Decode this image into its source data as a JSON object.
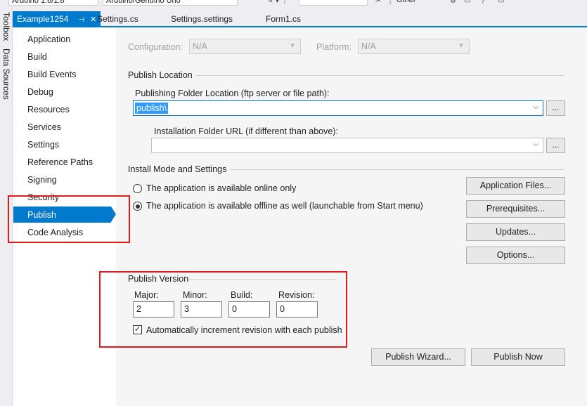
{
  "toolbar": {
    "board_combo": "Arduino 1.6/1.8",
    "port_combo": "Arduino/Genuino Uno",
    "search_combo": "",
    "other_combo": "Other"
  },
  "side_strip": {
    "toolbox": "Toolbox",
    "data_sources": "Data Sources"
  },
  "tabs": [
    {
      "label": "Example1254",
      "active": true
    },
    {
      "label": "Settings.cs"
    },
    {
      "label": "Settings.settings"
    },
    {
      "label": "Form1.cs"
    }
  ],
  "nav": {
    "items": [
      {
        "label": "Application"
      },
      {
        "label": "Build"
      },
      {
        "label": "Build Events"
      },
      {
        "label": "Debug"
      },
      {
        "label": "Resources"
      },
      {
        "label": "Services"
      },
      {
        "label": "Settings"
      },
      {
        "label": "Reference Paths"
      },
      {
        "label": "Signing"
      },
      {
        "label": "Security"
      },
      {
        "label": "Publish",
        "selected": true
      },
      {
        "label": "Code Analysis"
      }
    ]
  },
  "config": {
    "configuration_label": "Configuration:",
    "configuration_value": "N/A",
    "platform_label": "Platform:",
    "platform_value": "N/A"
  },
  "publish_location": {
    "section_title": "Publish Location",
    "folder_label": "Publishing Folder Location (ftp server or file path):",
    "folder_value": "publish\\",
    "install_label": "Installation Folder URL (if different than above):",
    "install_value": "",
    "browse_label": "..."
  },
  "install_mode": {
    "section_title": "Install Mode and Settings",
    "online_only": "The application is available online only",
    "offline": "The application is available offline as well (launchable from Start menu)",
    "selected": "offline",
    "buttons": {
      "application_files": "Application Files...",
      "prerequisites": "Prerequisites...",
      "updates": "Updates...",
      "options": "Options..."
    }
  },
  "publish_version": {
    "section_title": "Publish Version",
    "major_label": "Major:",
    "minor_label": "Minor:",
    "build_label": "Build:",
    "revision_label": "Revision:",
    "major": "2",
    "minor": "3",
    "build": "0",
    "revision": "0",
    "auto_increment_label": "Automatically increment revision with each publish",
    "auto_increment_checked": true
  },
  "actions": {
    "publish_wizard": "Publish Wizard...",
    "publish_now": "Publish Now"
  },
  "colors": {
    "accent": "#007acc",
    "highlight_box": "#e41b1b",
    "selection": "#3399ff"
  }
}
